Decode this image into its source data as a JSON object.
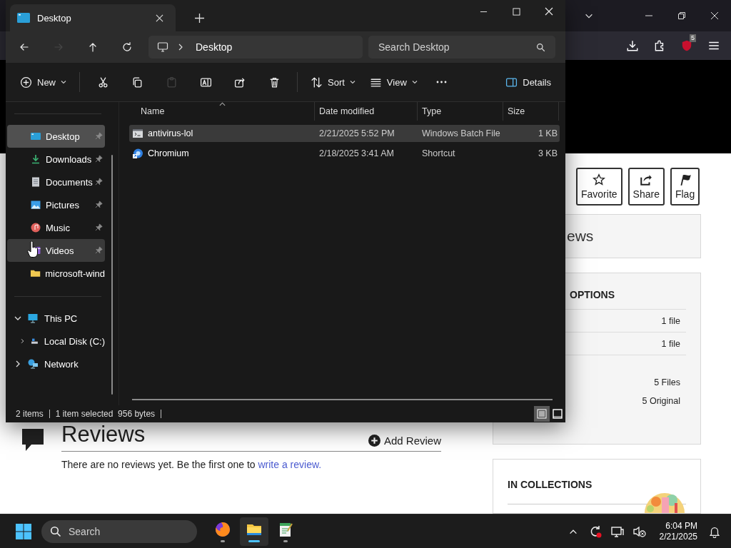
{
  "browser": {
    "toolbar": {
      "badge": "5"
    },
    "page": {
      "action_buttons": [
        {
          "kind": "favorite",
          "label": "Favorite"
        },
        {
          "kind": "share",
          "label": "Share"
        },
        {
          "kind": "flag",
          "label": "Flag"
        }
      ],
      "tab_fragment": "ews",
      "options": {
        "title": "OPTIONS",
        "rows": [
          {
            "value": "1 file",
            "divider": true
          },
          {
            "value": "1 file",
            "divider": true
          },
          {
            "value": "5 Files",
            "divider": false
          },
          {
            "value": "5 Original",
            "divider": false
          }
        ]
      },
      "collections": {
        "title": "IN COLLECTIONS"
      },
      "reviews": {
        "title": "Reviews",
        "add_button": "Add Review",
        "empty_text": "There are no reviews yet. Be the first one to ",
        "link": "write a review."
      }
    }
  },
  "explorer": {
    "tab": {
      "title": "Desktop"
    },
    "nav_buttons": [
      {
        "kind": "back",
        "disabled": false
      },
      {
        "kind": "forward",
        "disabled": true
      },
      {
        "kind": "up",
        "disabled": false
      },
      {
        "kind": "refresh",
        "disabled": false
      }
    ],
    "address": {
      "location": "Desktop"
    },
    "search": {
      "placeholder": "Search Desktop"
    },
    "commands": [
      {
        "kind": "new",
        "label": "New",
        "dropdown": true,
        "disabled": false
      },
      {
        "kind": "cut",
        "dropdown": false,
        "disabled": false
      },
      {
        "kind": "copy",
        "dropdown": false,
        "disabled": false
      },
      {
        "kind": "paste",
        "dropdown": false,
        "disabled": true
      },
      {
        "kind": "rename",
        "dropdown": false,
        "disabled": false
      },
      {
        "kind": "share",
        "dropdown": false,
        "disabled": false
      },
      {
        "kind": "delete",
        "dropdown": false,
        "disabled": false
      },
      {
        "kind": "sort",
        "label": "Sort",
        "dropdown": true,
        "disabled": false
      },
      {
        "kind": "view",
        "label": "View",
        "dropdown": true,
        "disabled": false
      },
      {
        "kind": "more",
        "dropdown": false,
        "disabled": false
      }
    ],
    "details_button": "Details",
    "sidebar": {
      "quick_access": [
        {
          "label": "Desktop",
          "kind": "desktop",
          "pinned": true,
          "selected": true,
          "hovered": false
        },
        {
          "label": "Downloads",
          "kind": "downloads",
          "pinned": true,
          "selected": false,
          "hovered": false
        },
        {
          "label": "Documents",
          "kind": "documents",
          "pinned": true,
          "selected": false,
          "hovered": false
        },
        {
          "label": "Pictures",
          "kind": "pictures",
          "pinned": true,
          "selected": false,
          "hovered": false
        },
        {
          "label": "Music",
          "kind": "music",
          "pinned": true,
          "selected": false,
          "hovered": false
        },
        {
          "label": "Videos",
          "kind": "videos",
          "pinned": true,
          "selected": false,
          "hovered": true
        },
        {
          "label": "microsoft-wind",
          "kind": "folder",
          "pinned": false,
          "selected": false,
          "hovered": false
        }
      ],
      "tree": [
        {
          "label": "This PC",
          "kind": "pc",
          "expanded": true,
          "selected": false,
          "children": [
            {
              "label": "Local Disk (C:)",
              "kind": "disk",
              "expanded": false,
              "selected": false
            }
          ]
        },
        {
          "label": "Network",
          "kind": "network",
          "expanded": false,
          "selected": false
        }
      ]
    },
    "table": {
      "columns": [
        {
          "label": "Name",
          "sorted": true
        },
        {
          "label": "Date modified",
          "sorted": false
        },
        {
          "label": "Type",
          "sorted": false
        },
        {
          "label": "Size",
          "sorted": false
        }
      ],
      "rows": [
        {
          "name": "antivirus-lol",
          "kind": "batch",
          "date": "2/21/2025 5:52 PM",
          "type": "Windows Batch File",
          "size": "1 KB",
          "selected": true
        },
        {
          "name": "Chromium",
          "kind": "shortcut",
          "date": "2/18/2025 3:41 AM",
          "type": "Shortcut",
          "size": "3 KB",
          "selected": false
        }
      ]
    },
    "status": {
      "item_count": "2 items",
      "selection": "1 item selected",
      "size": "956 bytes"
    },
    "view_modes": [
      {
        "kind": "details",
        "selected": true
      },
      {
        "kind": "preview",
        "selected": false
      }
    ]
  },
  "taskbar": {
    "search_placeholder": "Search",
    "apps": [
      {
        "kind": "firefox",
        "selected": false
      },
      {
        "kind": "explorer",
        "selected": true
      },
      {
        "kind": "editor",
        "selected": false
      }
    ],
    "time": "6:04 PM",
    "date": "2/21/2025"
  }
}
